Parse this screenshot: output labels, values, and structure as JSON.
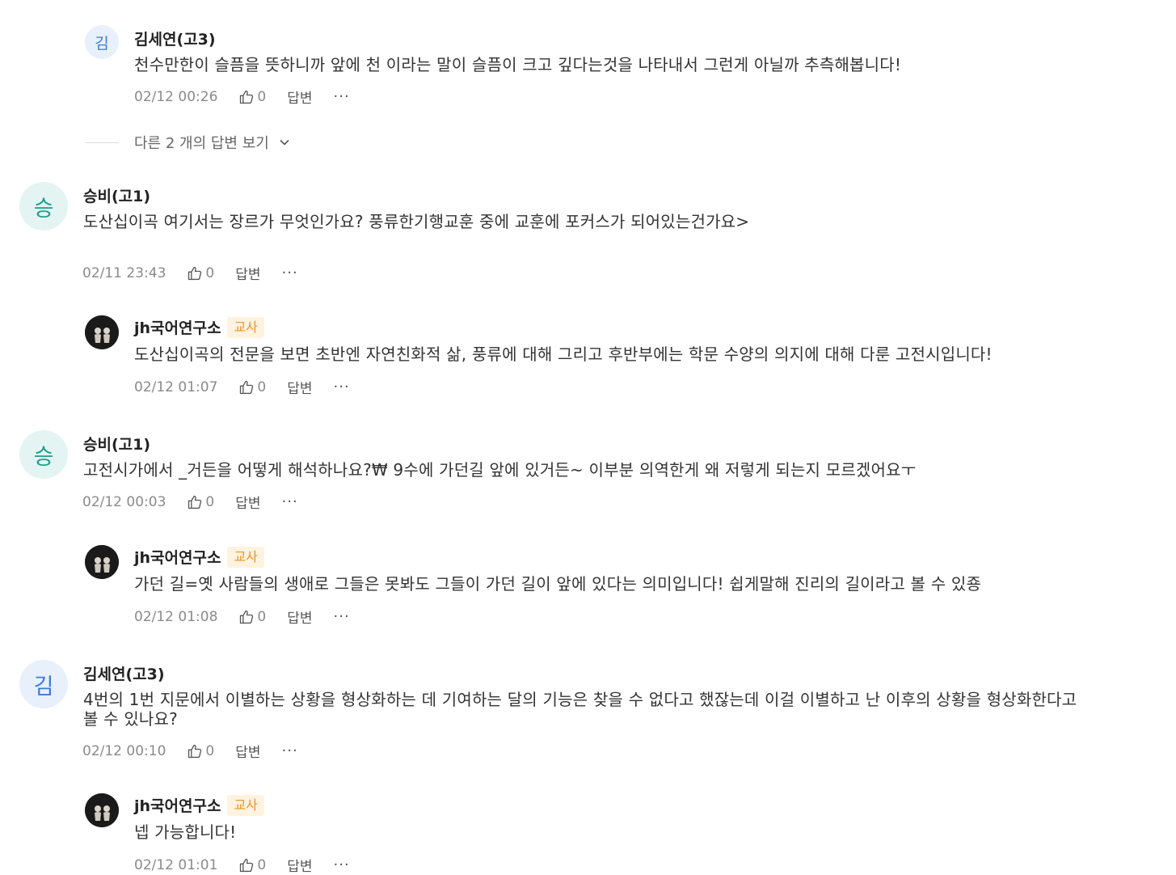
{
  "comments": [
    {
      "avatar_char": "김",
      "name": "김세연(고3)",
      "text": "천수만한이 슬픔을 뜻하니까 앞에 천 이라는 말이 슬픔이 크고 깊다는것을 나타내서 그런게 아닐까 추측해봅니다!",
      "date": "02/12 00:26",
      "likes": "0",
      "reply_label": "답변",
      "more_label": "···"
    },
    {
      "more_replies_label": "다른 2 개의 답변 보기"
    },
    {
      "avatar_char": "승",
      "name": "승비(고1)",
      "text": "도산십이곡 여기서는 장르가 무엇인가요? 풍류한기행교훈 중에 교훈에 포커스가 되어있는건가요>",
      "date": "02/11 23:43",
      "likes": "0",
      "reply_label": "답변",
      "more_label": "···"
    },
    {
      "name": "jh국어연구소",
      "badge": "교사",
      "text": "도산십이곡의 전문을 보면 초반엔 자연친화적 삶, 풍류에 대해 그리고 후반부에는 학문 수양의 의지에 대해 다룬 고전시입니다!",
      "date": "02/12 01:07",
      "likes": "0",
      "reply_label": "답변",
      "more_label": "···"
    },
    {
      "avatar_char": "승",
      "name": "승비(고1)",
      "text": "고전시가에서 _거든을 어떻게 해석하나요?₩ 9수에 가던길 앞에 있거든~ 이부분 의역한게 왜 저렇게 되는지 모르겠어요ㅜ",
      "date": "02/12 00:03",
      "likes": "0",
      "reply_label": "답변",
      "more_label": "···"
    },
    {
      "name": "jh국어연구소",
      "badge": "교사",
      "text": "가던 길=옛 사람들의 생애로 그들은 못봐도 그들이 가던 길이 앞에 있다는 의미입니다! 쉽게말해 진리의 길이라고 볼 수 있죵",
      "date": "02/12 01:08",
      "likes": "0",
      "reply_label": "답변",
      "more_label": "···"
    },
    {
      "avatar_char": "김",
      "name": "김세연(고3)",
      "text_line1": "4번의 1번 지문에서 이별하는 상황을 형상화하는 데 기여하는 달의 기능은 찾을 수 없다고 했잖는데 이걸 이별하고 난 이후의  상황을 형상화한다고",
      "text_line2": "볼 수 있나요?",
      "date": "02/12 00:10",
      "likes": "0",
      "reply_label": "답변",
      "more_label": "···"
    },
    {
      "name": "jh국어연구소",
      "badge": "교사",
      "text": "넵 가능합니다!",
      "date": "02/12 01:01",
      "likes": "0",
      "reply_label": "답변",
      "more_label": "···"
    }
  ]
}
